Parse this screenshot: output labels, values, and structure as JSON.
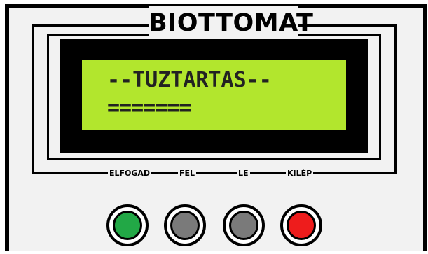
{
  "device": {
    "brand": "BIOTTOMAT"
  },
  "display": {
    "line1": "--TUZTARTAS--",
    "line2": "=======",
    "background_color": "#b2e62d"
  },
  "buttons": [
    {
      "label": "ELFOGAD",
      "color": "#22a846"
    },
    {
      "label": "FEL",
      "color": "#7a7a7a"
    },
    {
      "label": "LE",
      "color": "#7a7a7a"
    },
    {
      "label": "KILÉP",
      "color": "#ee1c1c"
    }
  ]
}
